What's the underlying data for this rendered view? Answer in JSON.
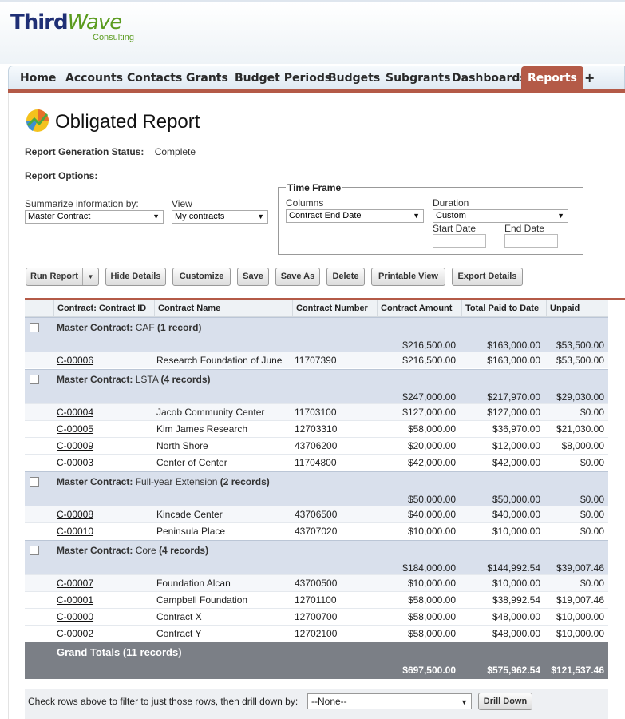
{
  "logo": {
    "main_left": "Third",
    "main_right": "Wave",
    "sub": "Consulting"
  },
  "tabs": [
    {
      "label": "Home"
    },
    {
      "label": "Accounts"
    },
    {
      "label": "Contacts"
    },
    {
      "label": "Grants"
    },
    {
      "label": "Budget Periods"
    },
    {
      "label": "Budgets"
    },
    {
      "label": "Subgrants"
    },
    {
      "label": "Dashboards"
    },
    {
      "label": "Reports"
    },
    {
      "label": "+"
    }
  ],
  "active_tab": "Reports",
  "colors": {
    "accent": "#b45a47",
    "group_bg": "#d9e0ec",
    "grand_bg": "#7b7f86"
  },
  "page": {
    "title": "Obligated Report",
    "title_icon": "report-chart-icon"
  },
  "status": {
    "label": "Report Generation Status:",
    "value": "Complete"
  },
  "options_label": "Report Options:",
  "summarize": {
    "label": "Summarize information by:",
    "value": "Master Contract"
  },
  "view": {
    "label": "View",
    "value": "My contracts"
  },
  "timeframe": {
    "legend": "Time Frame",
    "columns_label": "Columns",
    "columns_value": "Contract End Date",
    "duration_label": "Duration",
    "duration_value": "Custom",
    "start_label": "Start Date",
    "end_label": "End Date",
    "start_value": "",
    "end_value": ""
  },
  "buttons": {
    "run_report": "Run Report",
    "hide_details": "Hide Details",
    "customize": "Customize",
    "save": "Save",
    "save_as": "Save As",
    "delete": "Delete",
    "printable_view": "Printable View",
    "export_details": "Export Details"
  },
  "table": {
    "headers": [
      "Contract: Contract ID",
      "Contract Name",
      "Contract Number",
      "Contract Amount",
      "Total Paid to Date",
      "Unpaid"
    ],
    "group_prefix": "Master Contract:",
    "groups": [
      {
        "name": "CAF",
        "count": "(1 record)",
        "amount": "$216,500.00",
        "paid": "$163,000.00",
        "unpaid": "$53,500.00",
        "rows": [
          {
            "id": "C-00006",
            "name": "Research Foundation of June",
            "number": "11707390",
            "amount": "$216,500.00",
            "paid": "$163,000.00",
            "unpaid": "$53,500.00"
          }
        ]
      },
      {
        "name": "LSTA",
        "count": "(4 records)",
        "amount": "$247,000.00",
        "paid": "$217,970.00",
        "unpaid": "$29,030.00",
        "rows": [
          {
            "id": "C-00004",
            "name": "Jacob Community Center",
            "number": "11703100",
            "amount": "$127,000.00",
            "paid": "$127,000.00",
            "unpaid": "$0.00"
          },
          {
            "id": "C-00005",
            "name": "Kim James Research",
            "number": "12703310",
            "amount": "$58,000.00",
            "paid": "$36,970.00",
            "unpaid": "$21,030.00"
          },
          {
            "id": "C-00009",
            "name": "North Shore",
            "number": "43706200",
            "amount": "$20,000.00",
            "paid": "$12,000.00",
            "unpaid": "$8,000.00"
          },
          {
            "id": "C-00003",
            "name": "Center of Center",
            "number": "11704800",
            "amount": "$42,000.00",
            "paid": "$42,000.00",
            "unpaid": "$0.00"
          }
        ]
      },
      {
        "name": "Full-year Extension",
        "count": "(2 records)",
        "amount": "$50,000.00",
        "paid": "$50,000.00",
        "unpaid": "$0.00",
        "rows": [
          {
            "id": "C-00008",
            "name": "Kincade Center",
            "number": "43706500",
            "amount": "$40,000.00",
            "paid": "$40,000.00",
            "unpaid": "$0.00"
          },
          {
            "id": "C-00010",
            "name": "Peninsula Place",
            "number": "43707020",
            "amount": "$10,000.00",
            "paid": "$10,000.00",
            "unpaid": "$0.00"
          }
        ]
      },
      {
        "name": "Core",
        "count": "(4 records)",
        "amount": "$184,000.00",
        "paid": "$144,992.54",
        "unpaid": "$39,007.46",
        "rows": [
          {
            "id": "C-00007",
            "name": "Foundation Alcan",
            "number": "43700500",
            "amount": "$10,000.00",
            "paid": "$10,000.00",
            "unpaid": "$0.00"
          },
          {
            "id": "C-00001",
            "name": "Campbell Foundation",
            "number": "12701100",
            "amount": "$58,000.00",
            "paid": "$38,992.54",
            "unpaid": "$19,007.46"
          },
          {
            "id": "C-00000",
            "name": "Contract X",
            "number": "12700700",
            "amount": "$58,000.00",
            "paid": "$48,000.00",
            "unpaid": "$10,000.00"
          },
          {
            "id": "C-00002",
            "name": "Contract Y",
            "number": "12702100",
            "amount": "$58,000.00",
            "paid": "$48,000.00",
            "unpaid": "$10,000.00"
          }
        ]
      }
    ],
    "grand": {
      "label": "Grand Totals (11 records)",
      "amount": "$697,500.00",
      "paid": "$575,962.54",
      "unpaid": "$121,537.46"
    }
  },
  "drill": {
    "text": "Check rows above to filter to just those rows, then drill down by:",
    "value": "--None--",
    "button": "Drill Down"
  }
}
